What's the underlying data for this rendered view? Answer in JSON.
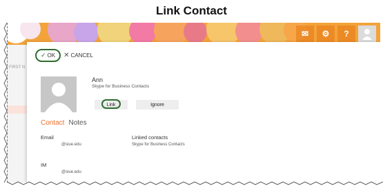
{
  "caption": "Link Contact",
  "header": {
    "icons": [
      {
        "name": "mail-icon",
        "glyph": "✉"
      },
      {
        "name": "gear-icon",
        "glyph": "⚙"
      },
      {
        "name": "help-icon",
        "glyph": "?"
      }
    ],
    "ghost_text": "FIRST N"
  },
  "command_bar": {
    "ok_label": "OK",
    "cancel_label": "CANCEL"
  },
  "contact": {
    "name": "Ann",
    "source": "Skype for Business Contacts",
    "link_label": "Link",
    "ignore_label": "Ignore"
  },
  "tabs": [
    {
      "label": "Contact",
      "active": true
    },
    {
      "label": "Notes",
      "active": false
    }
  ],
  "details": {
    "email_label": "Email",
    "email_value": "@siue.edu",
    "linked_label": "Linked contacts",
    "linked_value": "Skype for Business Contacts",
    "im_label": "IM",
    "im_value": "@siue.edu"
  },
  "colors": {
    "accent": "#e8702a",
    "highlight_ring": "#2e6b2e",
    "banner": "#f3a33a"
  }
}
